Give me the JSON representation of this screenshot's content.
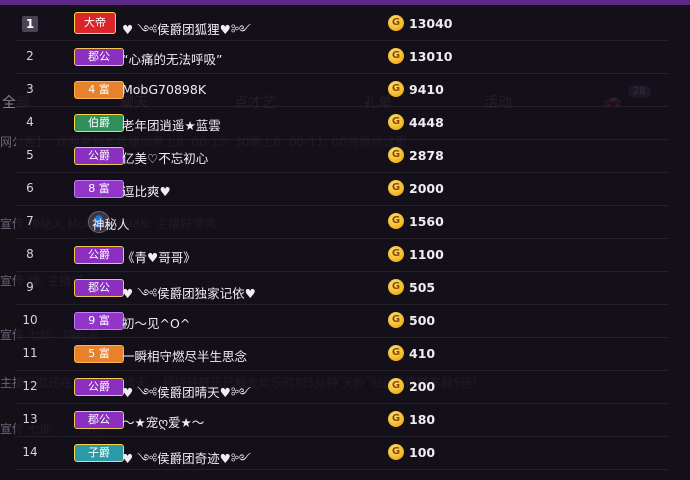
{
  "background": {
    "tabs": [
      "全部",
      "聊天",
      "点才艺",
      "礼单",
      "活动"
    ],
    "badge": "28",
    "lines": [
      "网公告】: 欢迎来到本直播间早上8: 00-12: 30晚上8: 00-11: 00充值点这里",
      "宣传  神秘人  MobG70898K: 主播好漂亮",
      "宣传                   嗨, 主播好",
      "宣传  七郎 : 嗨起来",
      "主播已监还在  ...侯爵团晴天...  超级转转乐已触发欢乐时刻3分钟'天外飞仙'获得概率翻5倍!",
      "宣传  七郎 ... : 你好"
    ]
  },
  "leaderboard": [
    {
      "rank": "1",
      "title": "大帝",
      "title_style": "dadi",
      "name": "♥ ༺侯爵团狐狸♥༻",
      "amount": "13040"
    },
    {
      "rank": "2",
      "title": "郡公",
      "title_style": "gong",
      "name": "“心痛的无法呼吸”",
      "amount": "13010"
    },
    {
      "rank": "3",
      "title": "4 富",
      "title_style": "fu",
      "name": "MobG70898K",
      "amount": "9410"
    },
    {
      "rank": "4",
      "title": "伯爵",
      "title_style": "bo",
      "name": "老年团逍遥★蓝雲",
      "amount": "4448"
    },
    {
      "rank": "5",
      "title": "公爵",
      "title_style": "gong",
      "name": "亿美♡不忘初心",
      "amount": "2878"
    },
    {
      "rank": "6",
      "title": "8 富",
      "title_style": "fu-purple",
      "name": "逗比爽♥",
      "amount": "2000"
    },
    {
      "rank": "7",
      "title": "",
      "title_style": "mystery",
      "name": "神秘人",
      "amount": "1560"
    },
    {
      "rank": "8",
      "title": "公爵",
      "title_style": "gong",
      "name": "《青♥哥哥》",
      "amount": "1100"
    },
    {
      "rank": "9",
      "title": "郡公",
      "title_style": "gong",
      "name": "♥ ༺侯爵团独家记依♥",
      "amount": "505"
    },
    {
      "rank": "10",
      "title": "9 富",
      "title_style": "fu-purple",
      "name": "初～见^O^",
      "amount": "500"
    },
    {
      "rank": "11",
      "title": "5 富",
      "title_style": "fu",
      "name": "一瞬相守燃尽半生思念",
      "amount": "410"
    },
    {
      "rank": "12",
      "title": "公爵",
      "title_style": "gong",
      "name": "♥ ༺侯爵团晴天♥༻",
      "amount": "200"
    },
    {
      "rank": "13",
      "title": "郡公",
      "title_style": "gong",
      "name": "～★宠ღ爱★～",
      "amount": "180"
    },
    {
      "rank": "14",
      "title": "子爵",
      "title_style": "zi",
      "name": "♥ ༺侯爵团奇迹♥༻",
      "amount": "100"
    }
  ],
  "coin_symbol": "G",
  "colors": {
    "accent": "#5b2a86",
    "coin": "#f2b21a"
  }
}
